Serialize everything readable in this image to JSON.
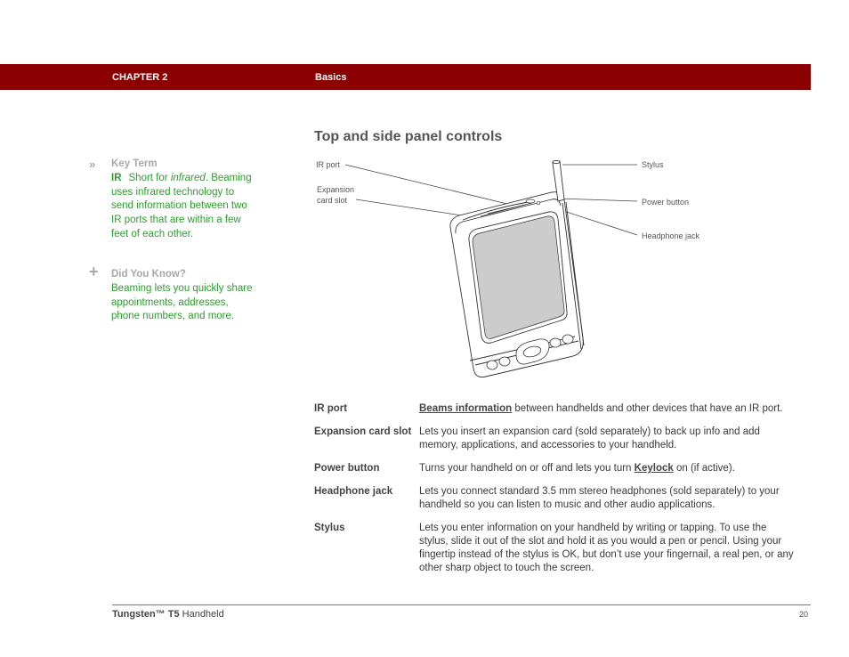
{
  "header": {
    "chapter": "CHAPTER 2",
    "section": "Basics",
    "bar_color": "#8b0000"
  },
  "sidebar": {
    "key_term": {
      "icon": "double-chevron-icon",
      "icon_glyph": "»",
      "title": "Key Term",
      "term": "IR",
      "definition_prefix": "Short for ",
      "definition_italic": "infrared",
      "definition_suffix": ". Beaming uses infrared technology to send information between two IR ports that are within a few feet of each other."
    },
    "did_you_know": {
      "icon": "plus-icon",
      "icon_glyph": "+",
      "title": "Did You Know?",
      "text": "Beaming lets you quickly share appointments, addresses, phone numbers, and more."
    },
    "text_color": "#2e9e2e",
    "title_color": "#a8a8a8"
  },
  "main": {
    "title": "Top and side panel controls",
    "figure": {
      "callouts": {
        "ir_port": "IR port",
        "expansion_line1": "Expansion",
        "expansion_line2": "card slot",
        "stylus": "Stylus",
        "power_button": "Power button",
        "headphone_jack": "Headphone jack"
      }
    },
    "definitions": [
      {
        "term": "IR port",
        "link": "Beams information",
        "text": " between handhelds and other devices that have an IR port."
      },
      {
        "term": "Expansion card slot",
        "text": "Lets you insert an expansion card (sold separately) to back up info and add memory, applications, and accessories to your handheld."
      },
      {
        "term": "Power button",
        "text_before": "Turns your handheld on or off and lets you turn ",
        "link": "Keylock",
        "text_after": " on (if active)."
      },
      {
        "term": "Headphone jack",
        "text": "Lets you connect standard 3.5 mm stereo headphones (sold separately) to your handheld so you can listen to music and other audio applications."
      },
      {
        "term": "Stylus",
        "text": "Lets you enter information on your handheld by writing or tapping. To use the stylus, slide it out of the slot and hold it as you would a pen or pencil. Using your fingertip instead of the stylus is OK, but don’t use your fingernail, a real pen, or any other sharp object to touch the screen."
      }
    ]
  },
  "footer": {
    "product_bold": "Tungsten™ T5",
    "product_rest": " Handheld",
    "page_number": "20"
  }
}
